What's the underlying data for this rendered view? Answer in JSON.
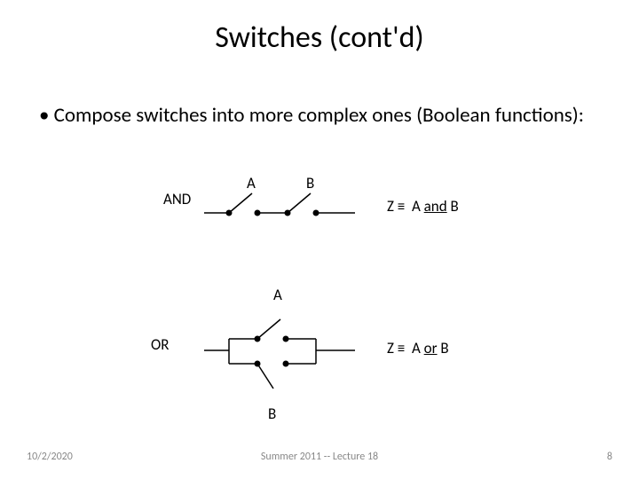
{
  "title": "Switches (cont'd)",
  "bullet_text": "Compose switches into more complex ones (Boolean functions):",
  "and_label": "AND",
  "or_label": "OR",
  "switch_labels": {
    "A": "A",
    "B": "B"
  },
  "eq_and": {
    "z": "Z",
    "equiv": "≡",
    "a": "A",
    "op": "and",
    "b": "B"
  },
  "eq_or": {
    "z": "Z",
    "equiv": "≡",
    "a": "A",
    "op": "or",
    "b": "B"
  },
  "footer": {
    "date": "10/2/2020",
    "center": "Summer 2011 -- Lecture 18",
    "page": "8"
  }
}
